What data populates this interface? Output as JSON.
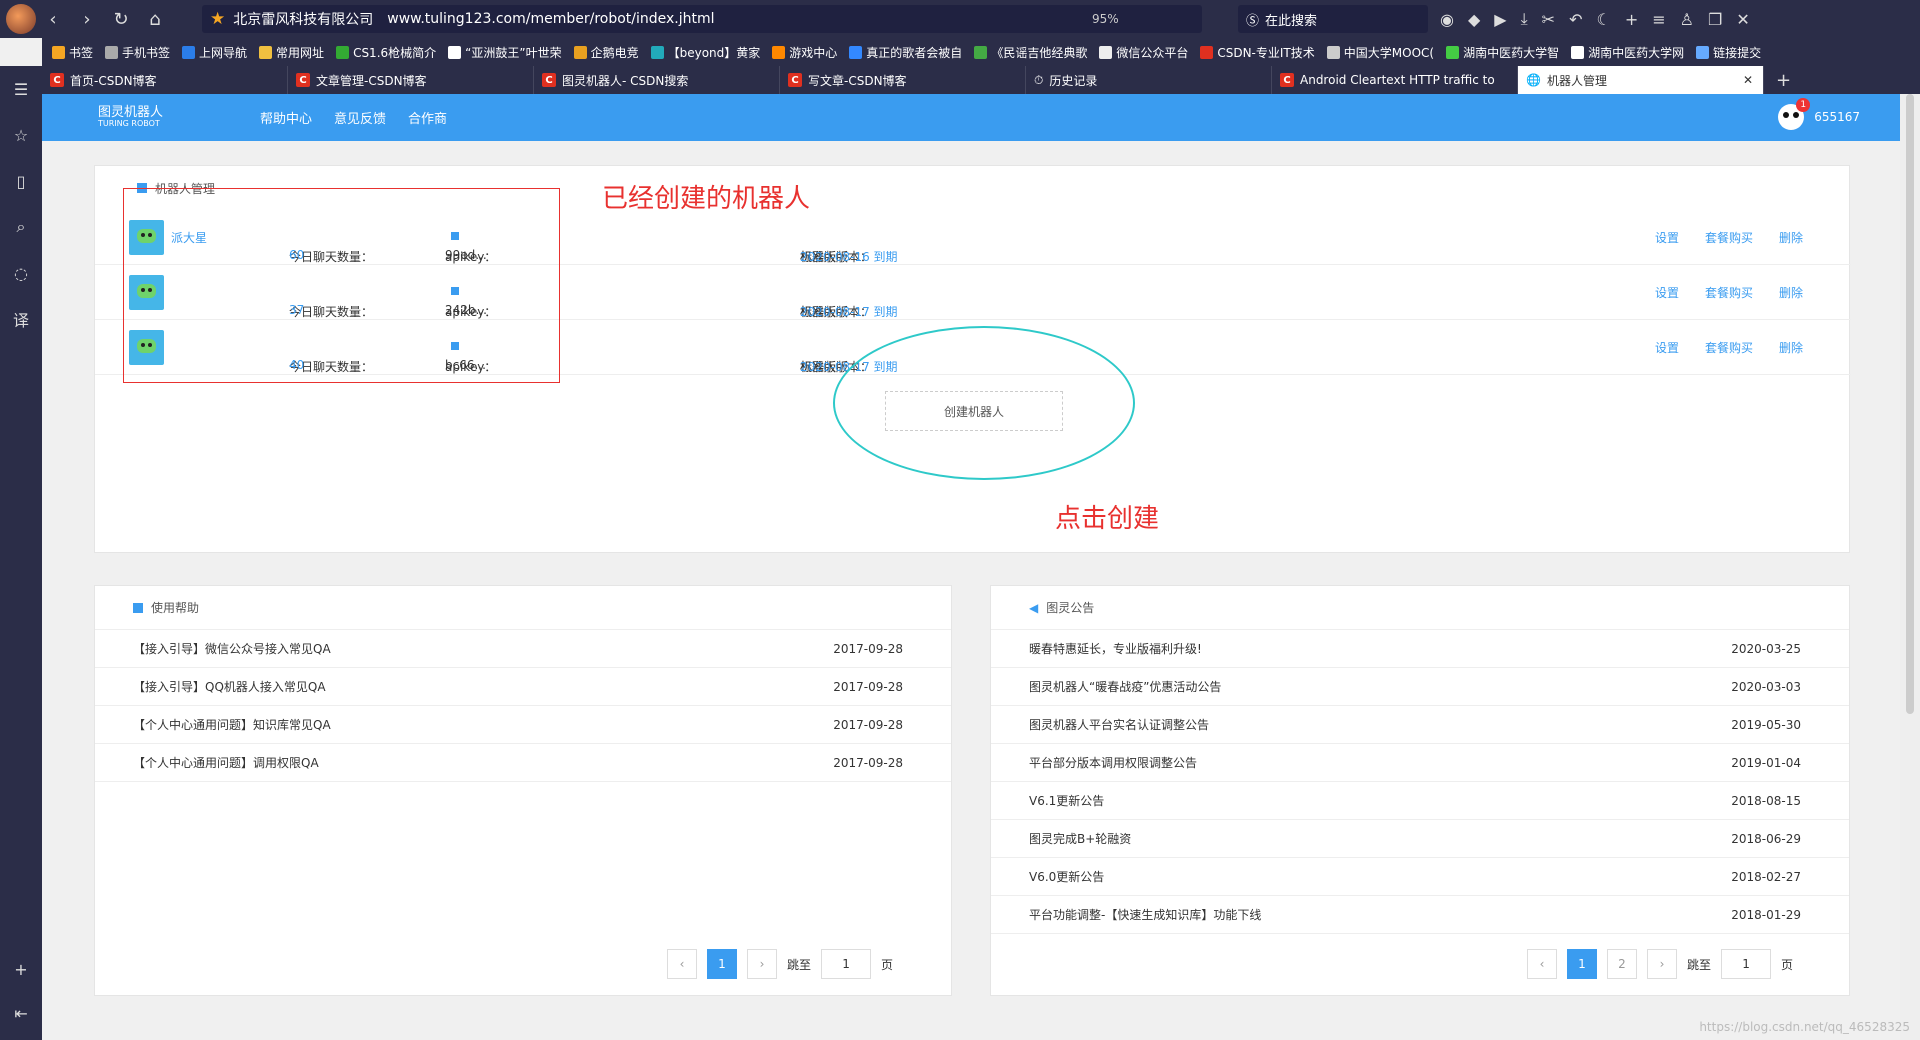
{
  "browser": {
    "site_name": "北京雷风科技有限公司",
    "url": "www.tuling123.com/member/robot/index.jhtml",
    "zoom": "95%",
    "search_placeholder": "在此搜索"
  },
  "bookmarks": [
    "书签",
    "手机书签",
    "上网导航",
    "常用网址",
    "CS1.6枪械简介",
    "“亚洲鼓王”叶世荣",
    "企鹅电竞",
    "【beyond】黄家",
    "游戏中心",
    "真正的歌者会被自",
    "《民谣吉他经典歌",
    "微信公众平台",
    "CSDN-专业IT技术",
    "中国大学MOOC(",
    "湖南中医药大学智",
    "湖南中医药大学网",
    "链接提交"
  ],
  "tabs": [
    "首页-CSDN博客",
    "文章管理-CSDN博客",
    "图灵机器人- CSDN搜索",
    "写文章-CSDN博客",
    "历史记录",
    "Android Cleartext HTTP traffic to",
    "机器人管理"
  ],
  "header": {
    "logo_cn": "图灵机器人",
    "logo_en": "TURING ROBOT",
    "nav": [
      "帮助中心",
      "意见反馈",
      "合作商"
    ],
    "user_id": "655167",
    "notif_count": "1"
  },
  "robots": {
    "title": "机器人管理",
    "chat_label": "今日聊天数量：",
    "apikey_label": "apikey：",
    "version_label": "机器人版本：",
    "version_type": "标准版",
    "actions": [
      "设置",
      "套餐购买",
      "删除"
    ],
    "rows": [
      {
        "name": "派大星",
        "chats": "60",
        "apikey": "99ed...",
        "expire": "2020-08-16 到期"
      },
      {
        "name": "",
        "chats": "37",
        "apikey": "242b...",
        "expire": "2020-08-17 到期"
      },
      {
        "name": "",
        "chats": "40",
        "apikey": "bc66...",
        "expire": "2020-08-17 到期"
      }
    ],
    "create_label": "创建机器人"
  },
  "annotations": {
    "created": "已经创建的机器人",
    "click": "点击创建"
  },
  "help": {
    "title": "使用帮助",
    "items": [
      {
        "text": "【接入引导】微信公众号接入常见QA",
        "date": "2017-09-28"
      },
      {
        "text": "【接入引导】QQ机器人接入常见QA",
        "date": "2017-09-28"
      },
      {
        "text": "【个人中心通用问题】知识库常见QA",
        "date": "2017-09-28"
      },
      {
        "text": "【个人中心通用问题】调用权限QA",
        "date": "2017-09-28"
      }
    ],
    "pages": [
      "1"
    ],
    "jump_label": "跳至",
    "page_value": "1",
    "page_suffix": "页"
  },
  "notice": {
    "title": "图灵公告",
    "items": [
      {
        "text": "暖春特惠延长，专业版福利升级!",
        "date": "2020-03-25"
      },
      {
        "text": "图灵机器人“暖春战疫”优惠活动公告",
        "date": "2020-03-03"
      },
      {
        "text": "图灵机器人平台实名认证调整公告",
        "date": "2019-05-30"
      },
      {
        "text": "平台部分版本调用权限调整公告",
        "date": "2019-01-04"
      },
      {
        "text": "V6.1更新公告",
        "date": "2018-08-15"
      },
      {
        "text": "图灵完成B+轮融资",
        "date": "2018-06-29"
      },
      {
        "text": "V6.0更新公告",
        "date": "2018-02-27"
      },
      {
        "text": "平台功能调整-【快速生成知识库】功能下线",
        "date": "2018-01-29"
      }
    ],
    "pages": [
      "1",
      "2"
    ],
    "jump_label": "跳至",
    "page_value": "1",
    "page_suffix": "页"
  },
  "watermark": "https://blog.csdn.net/qq_46528325"
}
